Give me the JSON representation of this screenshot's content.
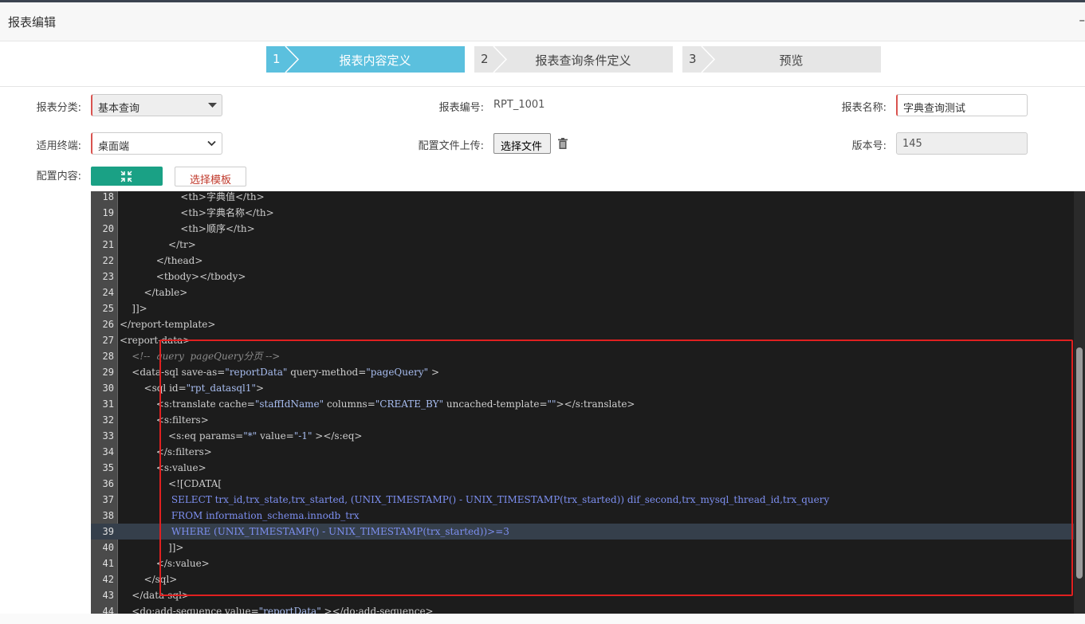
{
  "header": {
    "title": "报表编辑",
    "menu_glyph": "–"
  },
  "steps": [
    {
      "num": "1",
      "label": "报表内容定义"
    },
    {
      "num": "2",
      "label": "报表查询条件定义"
    },
    {
      "num": "3",
      "label": "预览"
    }
  ],
  "form": {
    "category_label": "报表分类:",
    "category_value": "基本查询",
    "code_label": "报表编号:",
    "code_value": "RPT_1001",
    "name_label": "报表名称:",
    "name_value": "字典查询测试",
    "terminal_label": "适用终端:",
    "terminal_value": "桌面端",
    "upload_label": "配置文件上传:",
    "upload_button": "选择文件",
    "version_label": "版本号:",
    "version_value": "145",
    "content_label": "配置内容:",
    "template_button": "选择模板"
  },
  "colors": {
    "accent_step": "#5bc0de",
    "teal": "#1aa185",
    "required": "#d9534f",
    "highlight_box": "#e02020"
  },
  "icons": {
    "collapse": "compress-icon",
    "delete": "trash-icon",
    "dropdown": "chevron-down-icon"
  },
  "editor": {
    "highlighted_line": "39",
    "lines": [
      {
        "n": "18",
        "parts": [
          [
            "                    ",
            "txt"
          ],
          [
            "<th>",
            "tag"
          ],
          [
            "字典值",
            "txt"
          ],
          [
            "</th>",
            "tag"
          ]
        ]
      },
      {
        "n": "19",
        "parts": [
          [
            "                    ",
            "txt"
          ],
          [
            "<th>",
            "tag"
          ],
          [
            "字典名称",
            "txt"
          ],
          [
            "</th>",
            "tag"
          ]
        ]
      },
      {
        "n": "20",
        "parts": [
          [
            "                    ",
            "txt"
          ],
          [
            "<th>",
            "tag"
          ],
          [
            "顺序",
            "txt"
          ],
          [
            "</th>",
            "tag"
          ]
        ]
      },
      {
        "n": "21",
        "parts": [
          [
            "                ",
            "txt"
          ],
          [
            "</tr>",
            "tag"
          ]
        ]
      },
      {
        "n": "22",
        "parts": [
          [
            "            ",
            "txt"
          ],
          [
            "</thead>",
            "tag"
          ]
        ]
      },
      {
        "n": "23",
        "parts": [
          [
            "            ",
            "txt"
          ],
          [
            "<tbody></tbody>",
            "tag"
          ]
        ]
      },
      {
        "n": "24",
        "parts": [
          [
            "        ",
            "txt"
          ],
          [
            "</table>",
            "tag"
          ]
        ]
      },
      {
        "n": "25",
        "parts": [
          [
            "    ",
            "txt"
          ],
          [
            "]]>",
            "tag"
          ]
        ]
      },
      {
        "n": "26",
        "parts": [
          [
            "",
            "txt"
          ],
          [
            "</report-template>",
            "tag"
          ]
        ]
      },
      {
        "n": "27",
        "parts": [
          [
            "",
            "txt"
          ],
          [
            "<report-data>",
            "tag"
          ]
        ]
      },
      {
        "n": "28",
        "parts": [
          [
            "    ",
            "txt"
          ],
          [
            "<!--  query  pageQuery分页 -->",
            "com"
          ]
        ]
      },
      {
        "n": "29",
        "parts": [
          [
            "    ",
            "txt"
          ],
          [
            "<data-sql save-as=",
            "tag"
          ],
          [
            "\"reportData\"",
            "str"
          ],
          [
            " query-method=",
            "tag"
          ],
          [
            "\"pageQuery\"",
            "str"
          ],
          [
            " >",
            "tag"
          ]
        ]
      },
      {
        "n": "30",
        "parts": [
          [
            "        ",
            "txt"
          ],
          [
            "<sql id=",
            "tag"
          ],
          [
            "\"rpt_datasql1\"",
            "str"
          ],
          [
            ">",
            "tag"
          ]
        ]
      },
      {
        "n": "31",
        "parts": [
          [
            "            ",
            "txt"
          ],
          [
            "<s:translate cache=",
            "tag"
          ],
          [
            "\"staffIdName\"",
            "str"
          ],
          [
            " columns=",
            "tag"
          ],
          [
            "\"CREATE_BY\"",
            "str"
          ],
          [
            " uncached-template=",
            "tag"
          ],
          [
            "\"\"",
            "str"
          ],
          [
            "></s:translate>",
            "tag"
          ]
        ]
      },
      {
        "n": "32",
        "parts": [
          [
            "            ",
            "txt"
          ],
          [
            "<s:filters>",
            "tag"
          ]
        ]
      },
      {
        "n": "33",
        "parts": [
          [
            "                ",
            "txt"
          ],
          [
            "<s:eq params=",
            "tag"
          ],
          [
            "\"*\"",
            "str"
          ],
          [
            " value=",
            "tag"
          ],
          [
            "\"-1\"",
            "str"
          ],
          [
            " ></s:eq>",
            "tag"
          ]
        ]
      },
      {
        "n": "34",
        "parts": [
          [
            "            ",
            "txt"
          ],
          [
            "</s:filters>",
            "tag"
          ]
        ]
      },
      {
        "n": "35",
        "parts": [
          [
            "            ",
            "txt"
          ],
          [
            "<s:value>",
            "tag"
          ]
        ]
      },
      {
        "n": "36",
        "parts": [
          [
            "                ",
            "txt"
          ],
          [
            "<![CDATA[",
            "tag"
          ]
        ]
      },
      {
        "n": "37",
        "parts": [
          [
            "                 ",
            "txt"
          ],
          [
            "SELECT trx_id,trx_state,trx_started, (UNIX_TIMESTAMP() - UNIX_TIMESTAMP(trx_started)) dif_second,trx_mysql_thread_id,trx_query",
            "sql"
          ]
        ]
      },
      {
        "n": "38",
        "parts": [
          [
            "                 ",
            "txt"
          ],
          [
            "FROM information_schema.innodb_trx",
            "sql"
          ]
        ]
      },
      {
        "n": "39",
        "parts": [
          [
            "                 ",
            "txt"
          ],
          [
            "WHERE (UNIX_TIMESTAMP() - UNIX_TIMESTAMP(trx_started))>=3",
            "sql"
          ]
        ]
      },
      {
        "n": "40",
        "parts": [
          [
            "                ",
            "txt"
          ],
          [
            "]]>",
            "tag"
          ]
        ]
      },
      {
        "n": "41",
        "parts": [
          [
            "            ",
            "txt"
          ],
          [
            "</s:value>",
            "tag"
          ]
        ]
      },
      {
        "n": "42",
        "parts": [
          [
            "        ",
            "txt"
          ],
          [
            "</sql>",
            "tag"
          ]
        ]
      },
      {
        "n": "43",
        "parts": [
          [
            "    ",
            "txt"
          ],
          [
            "</data-sql>",
            "tag"
          ]
        ]
      },
      {
        "n": "44",
        "parts": [
          [
            "    ",
            "txt"
          ],
          [
            "<do:add-sequence value=",
            "tag"
          ],
          [
            "\"reportData\"",
            "str"
          ],
          [
            " ></do:add-sequence>",
            "tag"
          ]
        ]
      }
    ]
  }
}
